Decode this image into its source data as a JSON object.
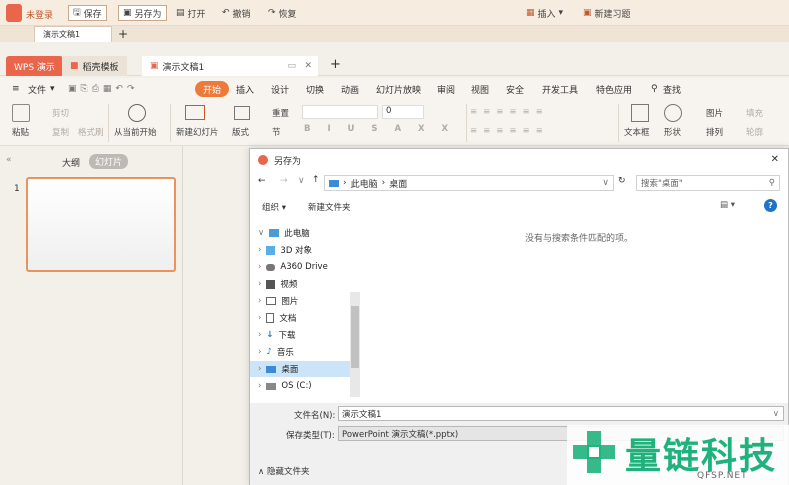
{
  "topbar": {
    "login": "未登录",
    "save": "保存",
    "save_as": "另存为",
    "open": "打开",
    "undo": "撤销",
    "redo": "恢复",
    "insert": "插入",
    "new_lesson": "新建习题"
  },
  "doc_tab": "演示文稿1",
  "app_tabs": {
    "wps": "WPS 演示",
    "template": "稻壳模板",
    "doc": "演示文稿1"
  },
  "menu": {
    "file": "文件",
    "items": [
      "开始",
      "插入",
      "设计",
      "切换",
      "动画",
      "幻灯片放映",
      "审阅",
      "视图",
      "安全",
      "开发工具",
      "特色应用"
    ],
    "search": "查找"
  },
  "ribbon": {
    "paste": "粘贴",
    "cut": "剪切",
    "copy": "复制",
    "format_painter": "格式刷",
    "from_current": "从当前开始",
    "new_slide": "新建幻灯片",
    "layout": "版式",
    "reset": "重置",
    "section": "节",
    "font_size": "0",
    "text_box": "文本框",
    "shape": "形状",
    "image": "图片",
    "arrange": "排列",
    "fill": "填充",
    "outline": "轮廓"
  },
  "left_panel": {
    "outline_tab": "大纲",
    "slides_tab": "幻灯片",
    "slide_number": "1"
  },
  "dialog": {
    "title": "另存为",
    "breadcrumb": [
      "此电脑",
      "桌面"
    ],
    "search_placeholder": "搜索\"桌面\"",
    "organize": "组织",
    "new_folder": "新建文件夹",
    "empty_message": "没有与搜索条件匹配的项。",
    "tree": [
      "此电脑",
      "3D 对象",
      "A360 Drive",
      "视频",
      "图片",
      "文档",
      "下载",
      "音乐",
      "桌面",
      "OS (C:)"
    ],
    "filename_label": "文件名(N):",
    "filename_value": "演示文稿1",
    "filetype_label": "保存类型(T):",
    "filetype_value": "PowerPoint 演示文稿(*.pptx)",
    "hide_folders": "隐藏文件夹"
  },
  "watermark": {
    "title": "量链科技",
    "url": "QFSP.NET"
  },
  "colors": {
    "accent": "#ec7b3b",
    "wps_red": "#e9664a",
    "watermark_green": "#20b27c"
  }
}
